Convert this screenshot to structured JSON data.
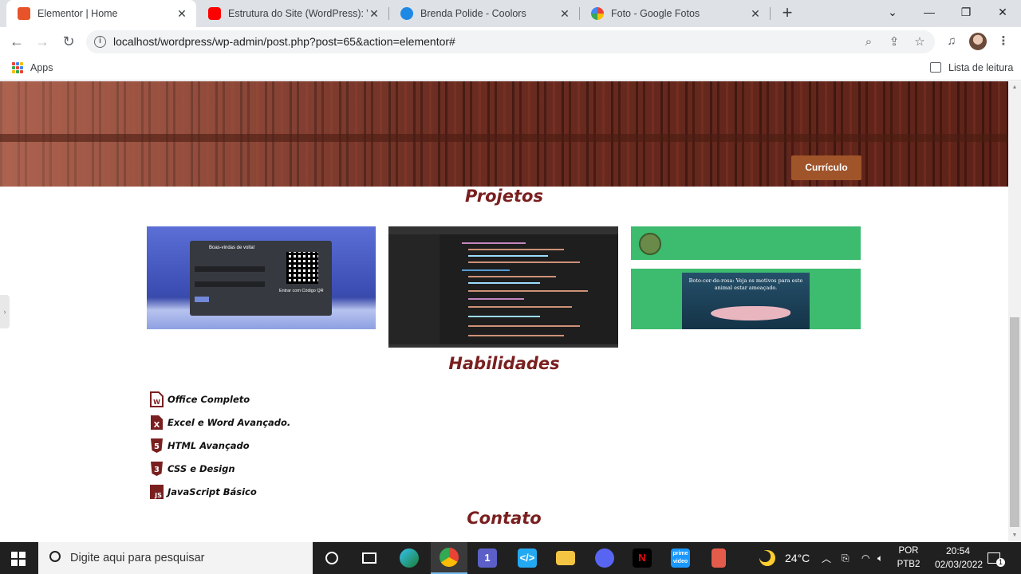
{
  "browser": {
    "tabs": [
      {
        "title": "Elementor | Home",
        "active": true,
        "favicon_color": "#e8542a"
      },
      {
        "title": "Estrutura do Site (WordPress): Víd",
        "active": false,
        "favicon_color": "#ff0000"
      },
      {
        "title": "Brenda Polide - Coolors",
        "active": false,
        "favicon_color": "#1e88e5"
      },
      {
        "title": "Foto - Google Fotos",
        "active": false,
        "favicon_color": "#fbbc04"
      }
    ],
    "url": "localhost/wordpress/wp-admin/post.php?post=65&action=elementor#",
    "bookmarks": {
      "apps_label": "Apps",
      "reading_list_label": "Lista de leitura"
    }
  },
  "page": {
    "cv_button_label": "Currículo",
    "projects_title": "Projetos",
    "projects": [
      {
        "name": "discord-login-project",
        "heading": "Boas-vindas de volta!",
        "qr_label": "Entrar com Código QR"
      },
      {
        "name": "vscode-code-project"
      },
      {
        "name": "boto-cor-de-rosa-project",
        "caption": "Boto-cor-de-rosa: Veja os motivos para este animal estar ameaçado."
      }
    ],
    "skills_title": "Habilidades",
    "skills": [
      {
        "label": "Office Completo",
        "icon": "word-icon",
        "badge": "W"
      },
      {
        "label": "Excel e Word Avançado.",
        "icon": "excel-icon",
        "badge": "X"
      },
      {
        "label": "HTML Avançado",
        "icon": "html5-icon",
        "badge": "5"
      },
      {
        "label": "CSS e Design",
        "icon": "css3-icon",
        "badge": "3"
      },
      {
        "label": "JavaScript Básico",
        "icon": "javascript-icon",
        "badge": "JS"
      }
    ],
    "contact_title": "Contato",
    "accent_color": "#7a1f1f"
  },
  "taskbar": {
    "search_placeholder": "Digite aqui para pesquisar",
    "weather": "24°C",
    "lang_line1": "POR",
    "lang_line2": "PTB2",
    "time": "20:54",
    "date": "02/03/2022",
    "teams_badge": "1",
    "notification_count": "1"
  }
}
